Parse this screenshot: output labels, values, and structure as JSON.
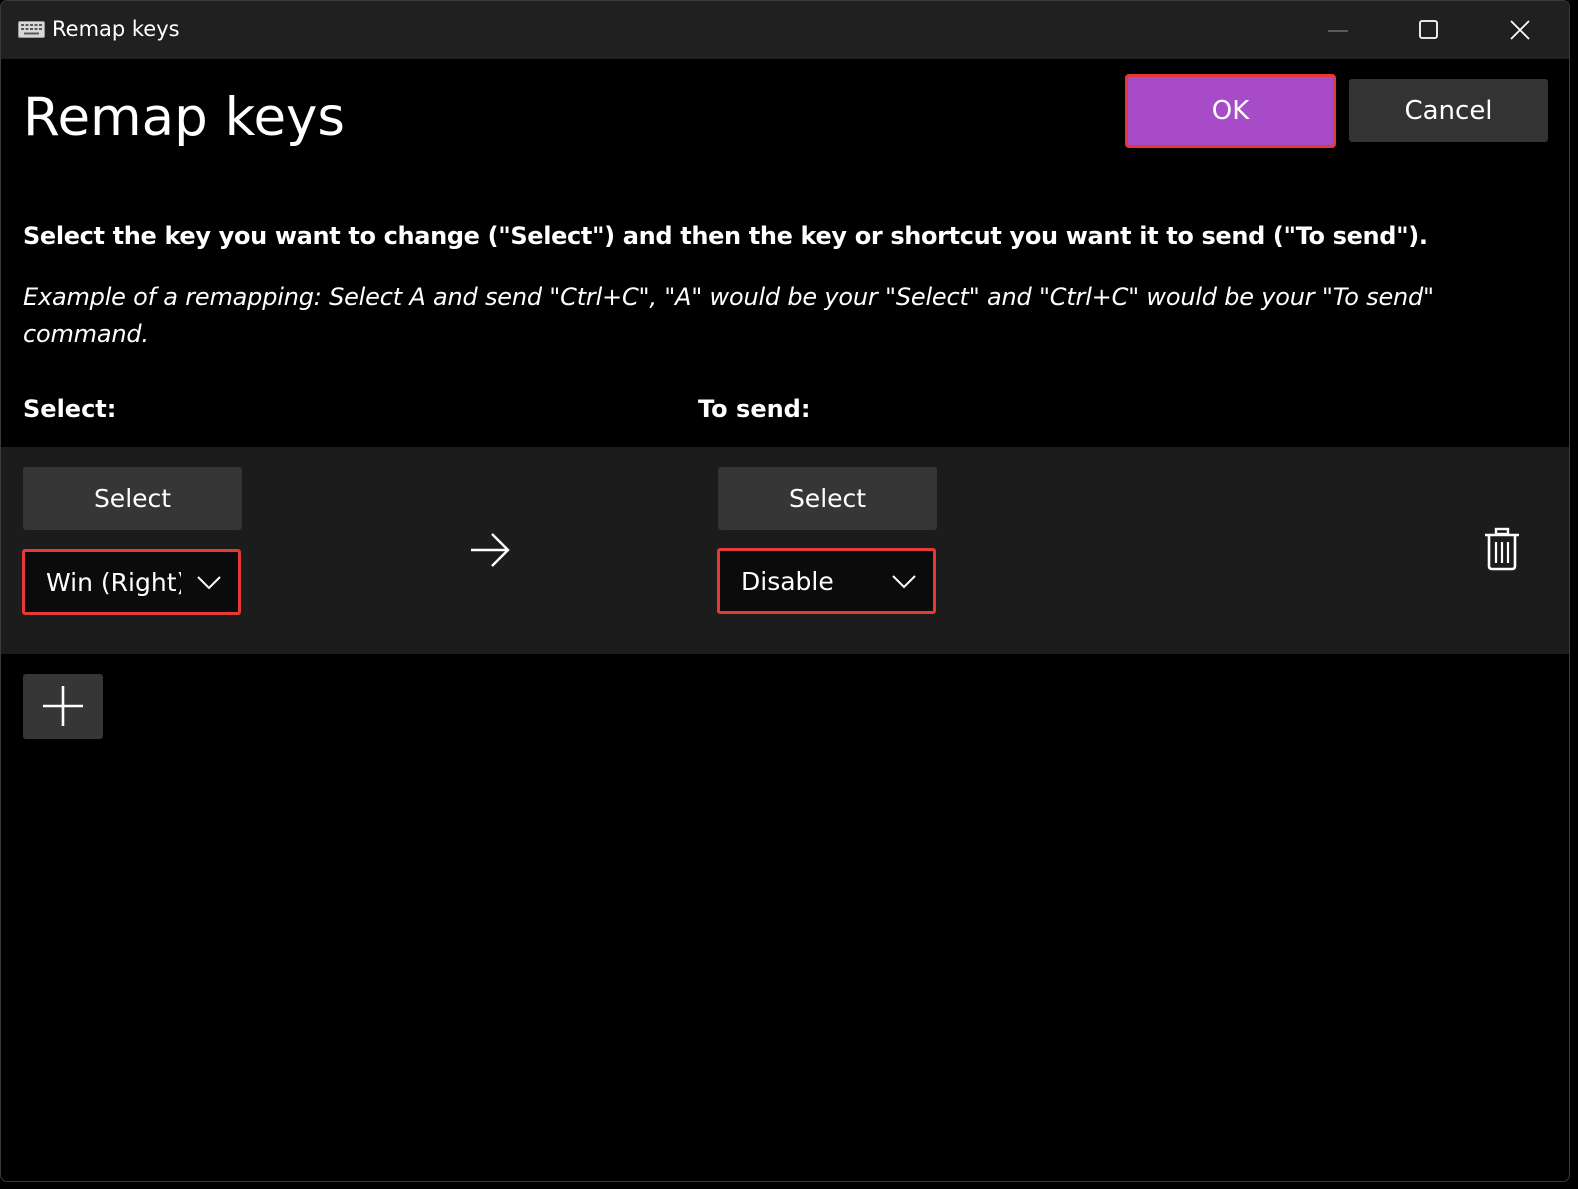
{
  "window": {
    "title": "Remap keys"
  },
  "header": {
    "title": "Remap keys",
    "ok_label": "OK",
    "cancel_label": "Cancel"
  },
  "instructions": {
    "main": "Select the key you want to change (\"Select\") and then the key or shortcut you want it to send (\"To send\").",
    "example": "Example of a remapping: Select A and send \"Ctrl+C\", \"A\" would be your \"Select\" and \"Ctrl+C\" would be your \"To send\" command."
  },
  "columns": {
    "select_label": "Select:",
    "send_label": "To send:"
  },
  "mapping": {
    "source_select_label": "Select",
    "source_value": "Win (Right)",
    "target_select_label": "Select",
    "target_value": "Disable"
  },
  "colors": {
    "accent": "#a84bc8",
    "highlight_border": "#e53935",
    "button_bg": "#363636",
    "row_bg": "#1c1c1c",
    "titlebar_bg": "#202020"
  },
  "icons": {
    "app": "keyboard-icon",
    "minimize": "minimize-icon",
    "maximize": "maximize-icon",
    "close": "close-icon",
    "arrow": "arrow-right-icon",
    "dropdown": "chevron-down-icon",
    "delete": "trash-icon",
    "add": "plus-icon"
  }
}
